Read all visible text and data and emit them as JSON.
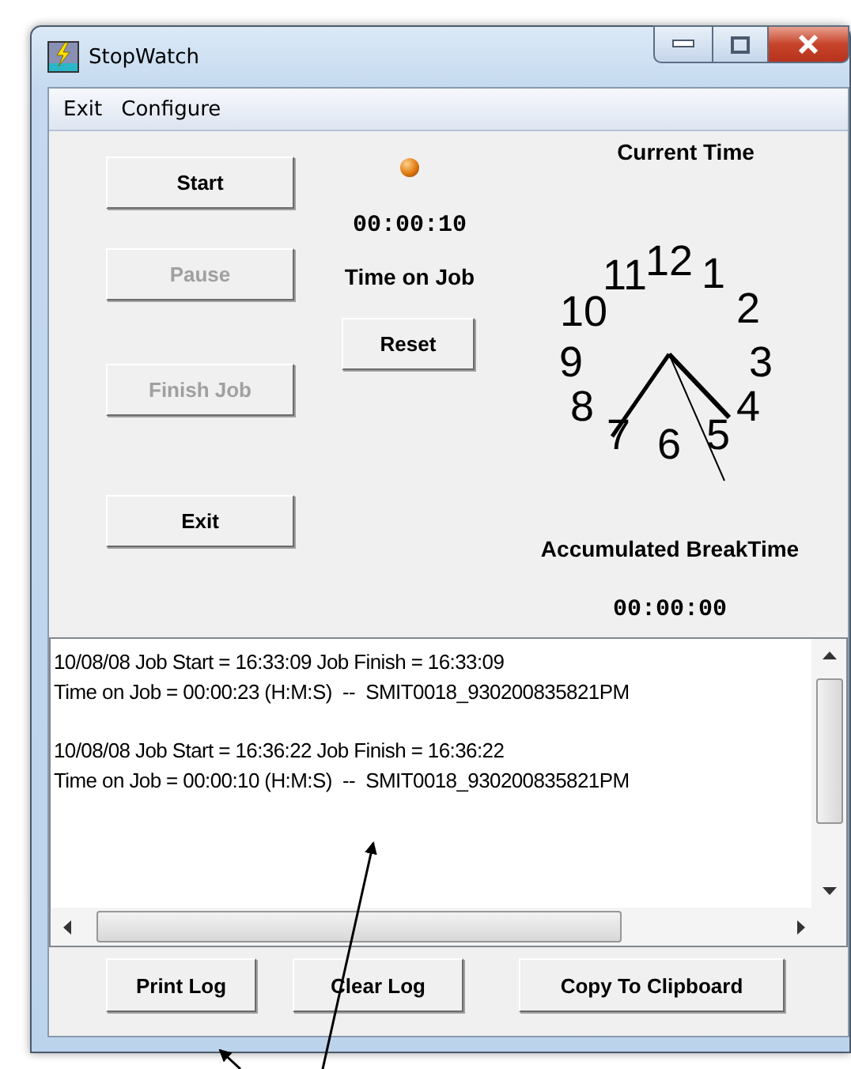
{
  "window": {
    "title": "StopWatch"
  },
  "menu": [
    {
      "label": "Exit"
    },
    {
      "label": "Configure"
    }
  ],
  "left_buttons": [
    {
      "label": "Start",
      "disabled": false
    },
    {
      "label": "Pause",
      "disabled": true
    },
    {
      "label": "Finish Job",
      "disabled": true
    },
    {
      "label": "Exit",
      "disabled": false
    }
  ],
  "job_timer": {
    "time": "00:00:10",
    "label": "Time on Job",
    "reset_button": "Reset"
  },
  "clock": {
    "title": "Current Time",
    "numerals": [
      "11",
      "12",
      "1",
      "10",
      "2",
      "9",
      "3",
      "8",
      "4",
      "7",
      "6",
      "5"
    ]
  },
  "break_timer": {
    "label": "Accumulated BreakTime",
    "time": "00:00:00"
  },
  "log": {
    "entries": [
      {
        "lines": [
          "10/08/08 Job Start = 16:33:09 Job Finish = 16:33:09",
          "Time on Job = 00:00:23 (H:M:S)  --  SMIT0018_930200835821PM"
        ]
      },
      {
        "lines": [
          "10/08/08 Job Start = 16:36:22 Job Finish = 16:36:22",
          "Time on Job = 00:00:10 (H:M:S)  --  SMIT0018_930200835821PM"
        ]
      }
    ]
  },
  "bottom_buttons": [
    {
      "label": "Print Log"
    },
    {
      "label": "Clear Log"
    },
    {
      "label": "Copy To Clipboard"
    }
  ]
}
